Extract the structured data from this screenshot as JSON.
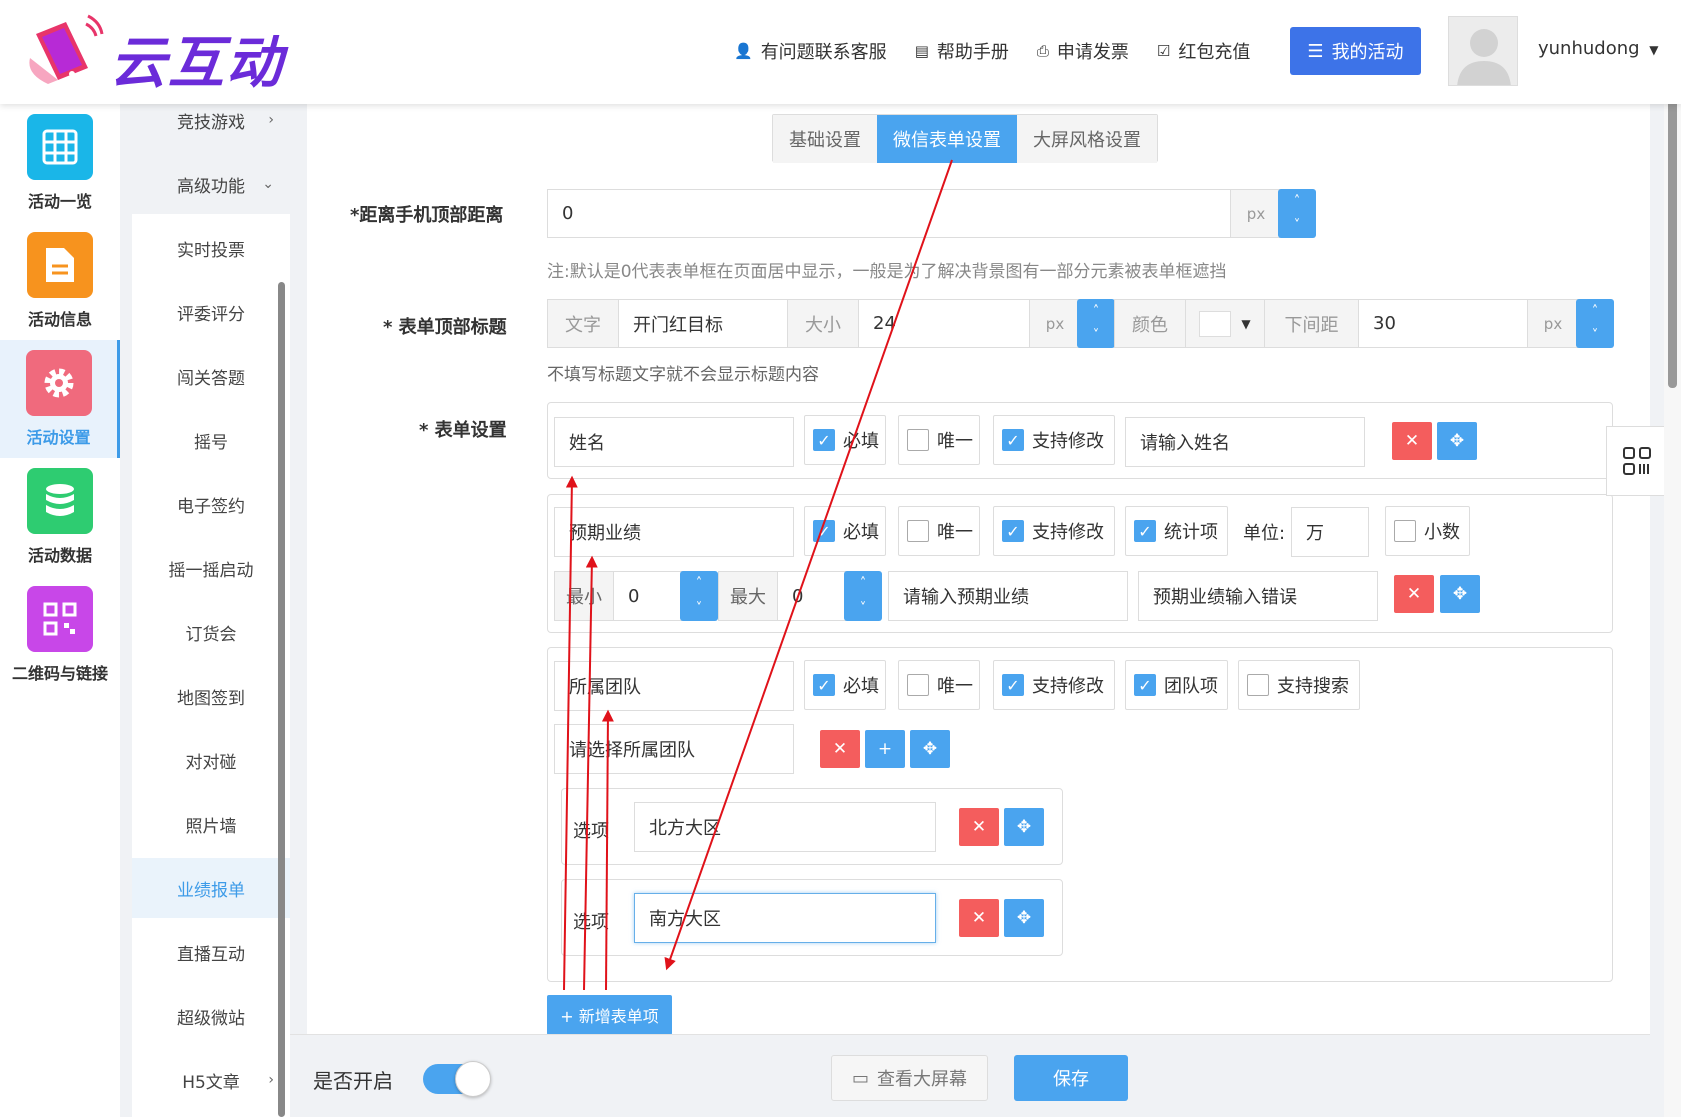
{
  "header": {
    "logo_text": "云互动",
    "nav": [
      {
        "label": "有问题联系客服",
        "icon": "user-plus-icon"
      },
      {
        "label": "帮助手册",
        "icon": "book-icon"
      },
      {
        "label": "申请发票",
        "icon": "printer-icon"
      },
      {
        "label": "红包充值",
        "icon": "shield-check-icon"
      }
    ],
    "my_activity": "我的活动",
    "username": "yunhudong"
  },
  "rail": [
    {
      "label": "活动一览",
      "color": "#1ab6e8",
      "icon": "grid-icon"
    },
    {
      "label": "活动信息",
      "color": "#f7931e",
      "icon": "document-icon"
    },
    {
      "label": "活动设置",
      "color": "#f06a7d",
      "icon": "gear-icon"
    },
    {
      "label": "活动数据",
      "color": "#2ecc71",
      "icon": "database-icon"
    },
    {
      "label": "二维码与链接",
      "color": "#c847e8",
      "icon": "qrcode-icon"
    }
  ],
  "submenu": [
    "竞技游戏",
    "高级功能",
    "实时投票",
    "评委评分",
    "闯关答题",
    "摇号",
    "电子签约",
    "摇一摇启动",
    "订货会",
    "地图签到",
    "对对碰",
    "照片墙",
    "业绩报单",
    "直播互动",
    "超级微站",
    "H5文章"
  ],
  "tabs": [
    "基础设置",
    "微信表单设置",
    "大屏风格设置"
  ],
  "form": {
    "top_distance_label": "*距离手机顶部距离",
    "top_distance_value": "0",
    "px": "px",
    "top_distance_hint": "注:默认是0代表表单框在页面居中显示，一般是为了解决背景图有一部分元素被表单框遮挡",
    "title_label": "* 表单顶部标题",
    "title_text_addon": "文字",
    "title_text_value": "开门红目标",
    "size_addon": "大小",
    "size_value": "24",
    "color_addon": "颜色",
    "bottom_gap_addon": "下间距",
    "bottom_gap_value": "30",
    "title_hint": "不填写标题文字就不会显示标题内容",
    "settings_label": "* 表单设置"
  },
  "checks": {
    "required": "必填",
    "unique": "唯一",
    "editable": "支持修改",
    "stat": "统计项",
    "unit_label": "单位:",
    "unit_value": "万",
    "decimal": "小数",
    "team": "团队项",
    "search": "支持搜索"
  },
  "items": {
    "name_field": "姓名",
    "name_placeholder": "请输入姓名",
    "perf_field": "预期业绩",
    "min_label": "最小",
    "min_value": "0",
    "max_label": "最大",
    "max_value": "0",
    "perf_placeholder": "请输入预期业绩",
    "perf_error": "预期业绩输入错误",
    "team_field": "所属团队",
    "team_placeholder": "请选择所属团队",
    "option_label": "选项",
    "option1": "北方大区",
    "option2": "南方大区"
  },
  "add_item": "+ 新增表单项",
  "footer": {
    "enable_label": "是否开启",
    "enabled": true,
    "view_screen": "查看大屏幕",
    "save": "保存"
  }
}
